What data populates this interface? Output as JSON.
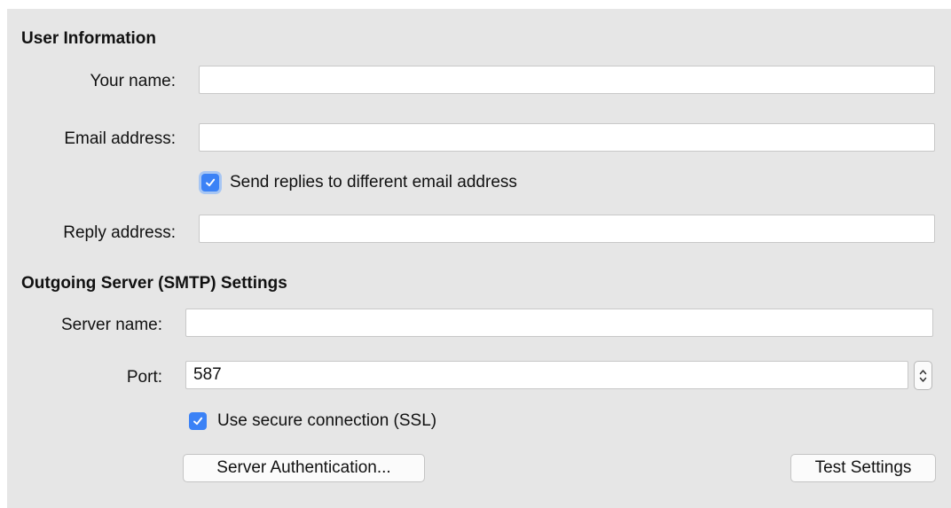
{
  "user_info": {
    "heading": "User Information",
    "your_name_label": "Your name:",
    "your_name_value": "",
    "email_label": "Email address:",
    "email_value": "",
    "reply_checkbox_label": "Send replies to different email address",
    "reply_checkbox_checked": true,
    "reply_label": "Reply address:",
    "reply_value": ""
  },
  "smtp": {
    "heading": "Outgoing Server (SMTP) Settings",
    "server_label": "Server name:",
    "server_value": "",
    "port_label": "Port:",
    "port_value": "587",
    "ssl_label": "Use secure connection (SSL)",
    "ssl_checked": true,
    "auth_button": "Server Authentication...",
    "test_button": "Test Settings"
  },
  "colors": {
    "accent": "#3b82f6",
    "panel_bg": "#e6e6e6"
  }
}
